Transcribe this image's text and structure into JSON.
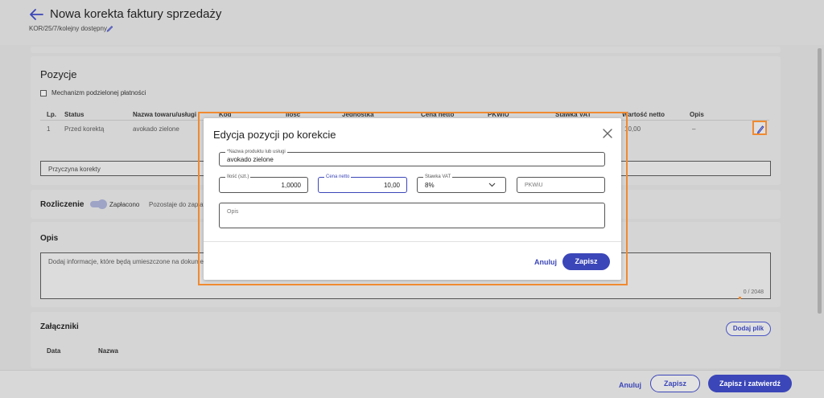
{
  "header": {
    "title": "Nowa korekta faktury sprzedaży",
    "doc_number": "KOR/25/7/kolejny dostępny"
  },
  "positions": {
    "title": "Pozycje",
    "split_payment_label": "Mechanizm podzielonej płatności",
    "columns": [
      "Lp.",
      "Status",
      "Nazwa towaru/usługi",
      "Kod",
      "Ilość",
      "Jednostka",
      "Cena netto",
      "PKWiU",
      "Stawka VAT",
      "Wartość netto",
      "Opis"
    ],
    "row": {
      "lp": "1",
      "status": "Przed korektą",
      "name": "avokado zielone",
      "net_value": "10,00",
      "opis": "–"
    },
    "reason_placeholder": "Przyczyna korekty"
  },
  "settlement": {
    "title": "Rozliczenie",
    "toggle_label": "Zapłacono",
    "remaining_label": "Pozostaje do zapłaty"
  },
  "description": {
    "title": "Opis",
    "placeholder": "Dodaj informacje, które będą umieszczone na dokumencie",
    "counter": "0 / 2048"
  },
  "attachments": {
    "title": "Załączniki",
    "add_button": "Dodaj plik",
    "columns": [
      "Data",
      "Nazwa"
    ]
  },
  "footer": {
    "cancel": "Anuluj",
    "save": "Zapisz",
    "save_confirm": "Zapisz i zatwierdź"
  },
  "modal": {
    "title": "Edycja pozycji po korekcie",
    "name_label": "*Nazwa produktu lub usługi",
    "name_value": "avokado zielone",
    "qty_label": "Ilość (szt.)",
    "qty_value": "1,0000",
    "price_label": "Cena netto",
    "price_value": "10,00",
    "vat_label": "Stawka VAT",
    "vat_value": "8%",
    "pkwiu_placeholder": "PKWiU",
    "opis_placeholder": "Opis",
    "cancel": "Anuluj",
    "save": "Zapisz"
  },
  "colors": {
    "accent": "#3b46b8",
    "highlight": "#f08a30"
  }
}
